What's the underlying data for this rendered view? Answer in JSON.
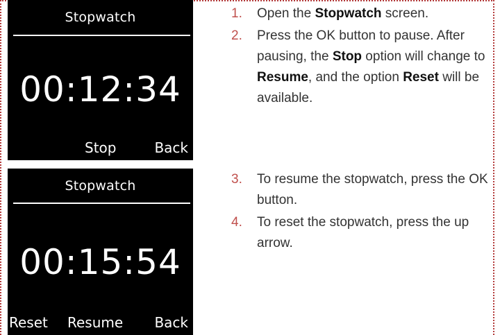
{
  "screens": [
    {
      "title": "Stopwatch",
      "time": "00:12:34",
      "softkeys": {
        "middle": "Stop",
        "right": "Back"
      }
    },
    {
      "title": "Stopwatch",
      "time": "00:15:54",
      "softkeys": {
        "left": "Reset",
        "middle": "Resume",
        "right": "Back"
      }
    }
  ],
  "steps": [
    {
      "num": "1.",
      "p1": "Open the ",
      "b1": "Stopwatch",
      "p2": " screen."
    },
    {
      "num": "2.",
      "p1": "Press the OK button to pause. After pausing, the ",
      "b1": "Stop",
      "p2": " option will change to ",
      "b2": "Resume",
      "p3": ", and the option ",
      "b3": "Reset",
      "p4": " will be available."
    },
    {
      "num": "3.",
      "p1": "To resume the stopwatch, press the OK button."
    },
    {
      "num": "4.",
      "p1": "To reset the stopwatch, press the up arrow."
    }
  ],
  "colors": {
    "accent": "#c0504d",
    "screen_bg": "#000000",
    "screen_fg": "#ffffff"
  }
}
